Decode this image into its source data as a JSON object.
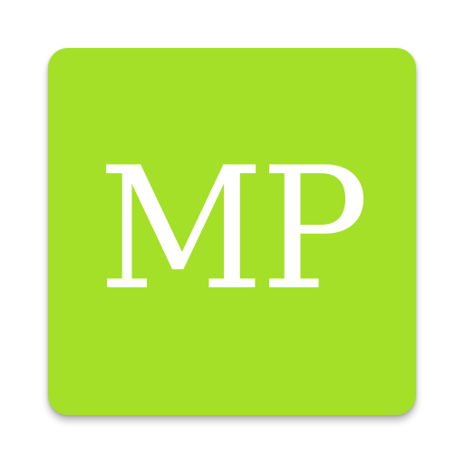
{
  "icon": {
    "monogram": "MP",
    "background_color": "#a4e027",
    "text_color": "#ffffff"
  }
}
